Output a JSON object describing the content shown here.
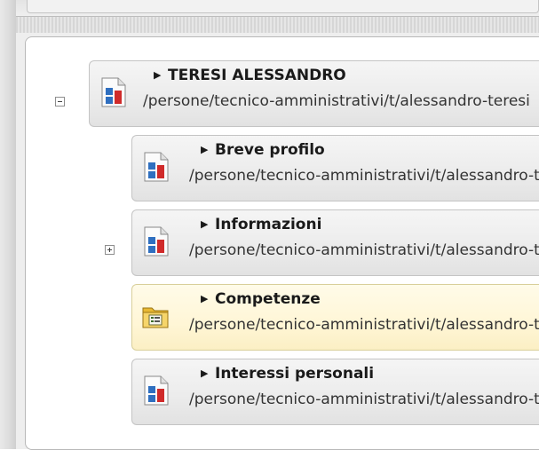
{
  "tree": {
    "root": {
      "title": "TERESI ALESSANDRO",
      "path": "/persone/tecnico-amministrativi/t/alessandro-teresi",
      "expanded": true,
      "icon": "document-chart-icon"
    },
    "children": [
      {
        "title": "Breve profilo",
        "path": "/persone/tecnico-amministrativi/t/alessandro-teresi/breve-profilo",
        "icon": "document-chart-icon",
        "has_toggle": false
      },
      {
        "title": "Informazioni",
        "path": "/persone/tecnico-amministrativi/t/alessandro-teresi/informazioni",
        "icon": "document-chart-icon",
        "has_toggle": true,
        "expanded": false
      },
      {
        "title": "Competenze",
        "path": "/persone/tecnico-amministrativi/t/alessandro-teresi/competenze",
        "icon": "folder-icon",
        "has_toggle": false,
        "highlighted": true
      },
      {
        "title": "Interessi personali",
        "path": "/persone/tecnico-amministrativi/t/alessandro-teresi/interessi-personali",
        "icon": "document-chart-icon",
        "has_toggle": false
      }
    ]
  },
  "colors": {
    "node_bg": "#ececec",
    "highlight_bg": "#fff6d6",
    "border": "#c4c4c4",
    "icon_blue": "#2f6fc0",
    "icon_red": "#d02a2a"
  }
}
